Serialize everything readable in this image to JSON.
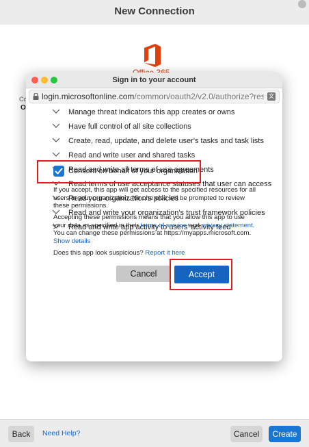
{
  "outer": {
    "title": "New Connection",
    "back_label": "Back",
    "help_label": "Need Help?",
    "cancel_label": "Cancel",
    "create_label": "Create",
    "logo_text": "Office 365",
    "frag_co": "Co",
    "frag_o": "O"
  },
  "modal": {
    "title": "Sign in to your account",
    "url_host": "login.microsoftonline.com",
    "url_path": "/common/oauth2/v2.0/authorize?resp...",
    "permissions": [
      "Manage threat indicators this app creates or owns",
      "Have full control of all site collections",
      "Create, read, update, and delete user's tasks and task lists",
      "Read and write user and shared tasks",
      "Read and write all terms of use agreements",
      "Read terms of use acceptance statuses that user can access",
      "Read your organization's policies",
      "Read and write your organization's trust framework policies",
      "Read and write app activity to users' activity feed"
    ],
    "consent_label": "Consent on behalf of your organization",
    "consent_checked": true,
    "para1": "If you accept, this app will get access to the specified resources for all users in your organization. No one else will be prompted to review these permissions.",
    "para2_a": "Accepting these permissions means that you allow this app to use your data as specified in their ",
    "terms_link": "terms of service",
    "para2_b": " and ",
    "privacy_link": "privacy statement",
    "para2_c": ". You can change these permissions at https://myapps.microsoft.com. ",
    "show_details_link": "Show details",
    "suspicious_text": "Does this app look suspicious? ",
    "report_link": "Report it here",
    "cancel_label": "Cancel",
    "accept_label": "Accept"
  },
  "colors": {
    "accent": "#1565c0",
    "highlight_red": "#e41b1b",
    "office_orange": "#e2400a"
  }
}
